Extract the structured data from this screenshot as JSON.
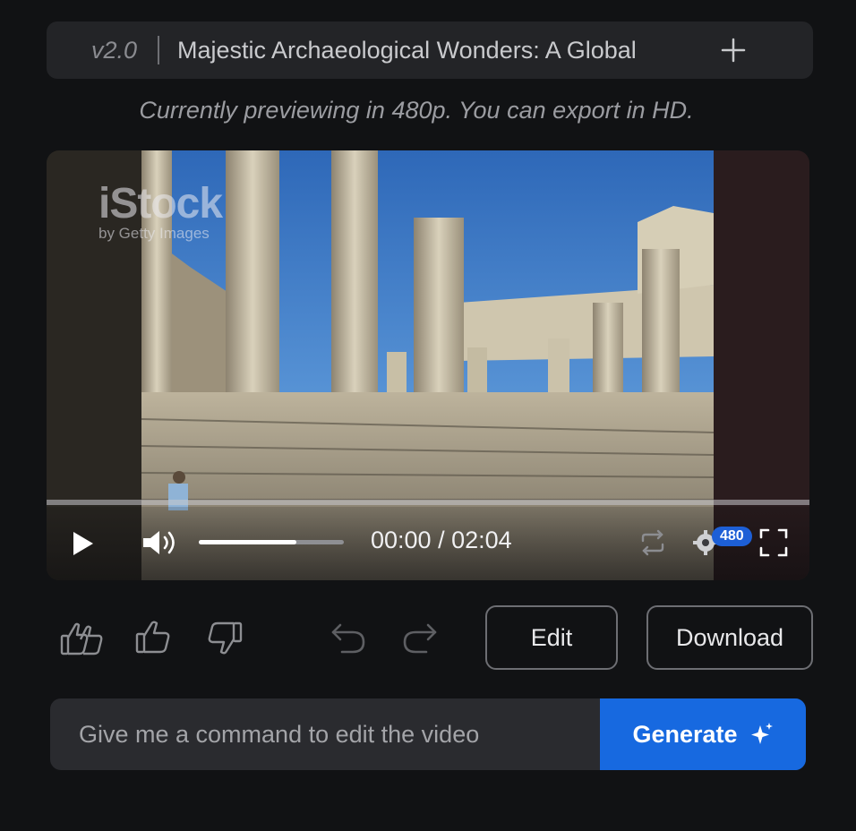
{
  "header": {
    "version": "v2.0",
    "title": "Majestic Archaeological Wonders: A Global",
    "add_icon": "plus-icon"
  },
  "preview_notice": "Currently previewing in 480p. You can export in HD.",
  "video": {
    "watermark": {
      "brand": "iStock",
      "byline": "by Getty Images"
    },
    "playback_progress": 0.0,
    "volume_level": 0.67,
    "time": "00:00 / 02:04",
    "quality": "480",
    "icons": [
      "play-icon",
      "volume-icon",
      "loop-icon",
      "settings-gear-icon",
      "fullscreen-icon"
    ]
  },
  "actions": {
    "icons": [
      "double-thumbs-up-icon",
      "thumbs-up-icon",
      "thumbs-down-icon",
      "undo-icon",
      "redo-icon"
    ],
    "edit_label": "Edit",
    "download_label": "Download"
  },
  "command": {
    "placeholder": "Give me a command to edit the video",
    "value": "",
    "generate_label": "Generate",
    "generate_icon": "sparkle-icon"
  },
  "colors": {
    "background": "#111214",
    "panel": "#232427",
    "accent": "#1769e0",
    "badge": "#1d5fd6"
  }
}
